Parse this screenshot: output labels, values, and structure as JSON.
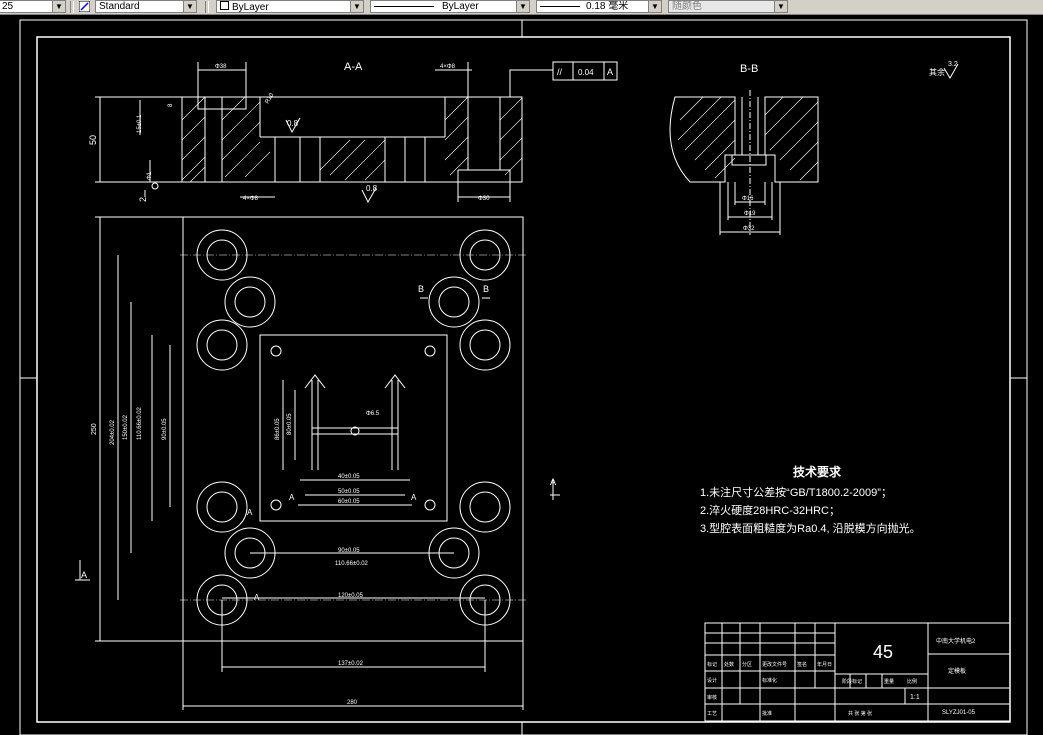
{
  "toolbar": {
    "textstyle_partial": "25",
    "dimstyle": "Standard",
    "layer": "ByLayer",
    "linetype": "ByLayer",
    "lineweight": "0.18 毫米",
    "plotstyle": "随颜色"
  },
  "section_aa": {
    "label": "A-A",
    "dim_top": "Φ38",
    "dim_top2": "4×Φ8",
    "dim_height": "50",
    "dim_left1": "2",
    "dim_left2": "Φ1",
    "dim_bottom1": "4×Φ8",
    "dim_bottom2": "Φ30",
    "rough1": "0.8",
    "rough2": "0.8",
    "small_dim1": "R10",
    "small_dim2": "15±0.1",
    "small_dim3": "8"
  },
  "tolerance_frame": {
    "symbol": "//",
    "value": "0.04",
    "datum": "A"
  },
  "section_bb": {
    "label": "B-B",
    "d1": "Φ16",
    "d2": "Φ19",
    "d3": "Φ32"
  },
  "roughness_note": {
    "prefix": "其余",
    "value": "3.2"
  },
  "plan_view": {
    "dim_overall_w": "280",
    "dim_overall_h": "250",
    "dim_h1": "204±0.02",
    "dim_h2": "150±0.02",
    "dim_h3": "110.66±0.02",
    "dim_h4": "90±0.05",
    "dim_h5": "86±0.05",
    "dim_h6": "80±0.05",
    "dim_w1": "40±0.05",
    "dim_w2": "50±0.05",
    "dim_w3": "60±0.05",
    "dim_w4": "90±0.05",
    "dim_w5": "110.66±0.02",
    "dim_w6": "120±0.05",
    "dim_w7": "137±0.02",
    "dim_r": "Φ6.5",
    "section_mark_a": "A",
    "section_mark_b": "B"
  },
  "tech_requirements": {
    "title": "技术要求",
    "items": [
      "1.未注尺寸公差按“GB/T1800.2-2009”；",
      "2.淬火硬度28HRC-32HRC；",
      "3.型腔表面粗糙度为Ra0.4, 沿脱模方向抛光。"
    ]
  },
  "title_block": {
    "material": "45",
    "school": "中南大学机电2",
    "part_name": "定模板",
    "scale": "1:1",
    "drawing_no": "SLYZJ01-05",
    "sheet": "共 张  第 张",
    "rows": [
      "标记",
      "处数",
      "分区",
      "更改文件号",
      "签名",
      "年月日"
    ],
    "row2": [
      "设计",
      "标准化",
      "阶段标记",
      "重量",
      "比例"
    ],
    "row3": [
      "审核"
    ],
    "row4": [
      "工艺",
      "批准"
    ]
  }
}
